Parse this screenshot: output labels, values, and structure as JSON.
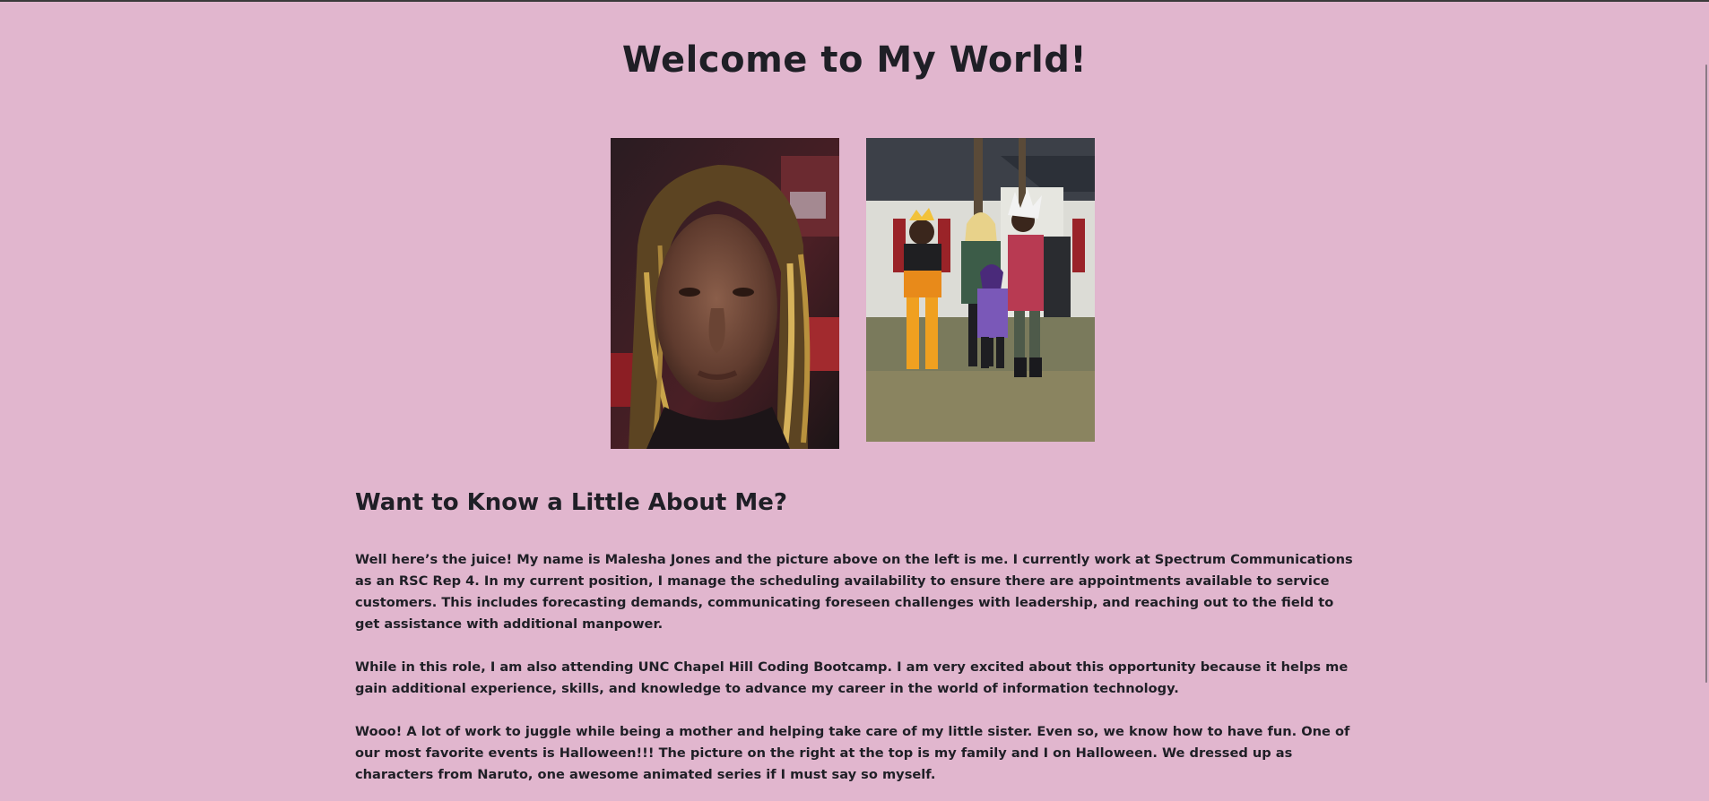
{
  "page": {
    "title": "Welcome to My World!",
    "background": "#e1b6ce",
    "text_color": "#1f1f26"
  },
  "photos": {
    "left_icon": "selfie-photo",
    "right_icon": "family-halloween-photo"
  },
  "about": {
    "heading": "Want to Know a Little About Me?",
    "paragraphs": [
      "Well here’s the juice! My name is Malesha Jones and the picture above on the left is me. I currently work at Spectrum Communications as an RSC Rep 4. In my current position, I manage the scheduling availability to ensure there are appointments available to service customers. This includes forecasting demands, communicating foreseen challenges with leadership, and reaching out to the field to get assistance with additional manpower.",
      "While in this role, I am also attending UNC Chapel Hill Coding Bootcamp. I am very excited about this opportunity because it helps me gain additional experience, skills, and knowledge to advance my career in the world of information technology.",
      "Wooo! A lot of work to juggle while being a mother and helping take care of my little sister. Even so, we know how to have fun. One of our most favorite events is Halloween!!! The picture on the right at the top is my family and I on Halloween. We dressed up as characters from Naruto, one awesome animated series if I must say so myself."
    ]
  }
}
